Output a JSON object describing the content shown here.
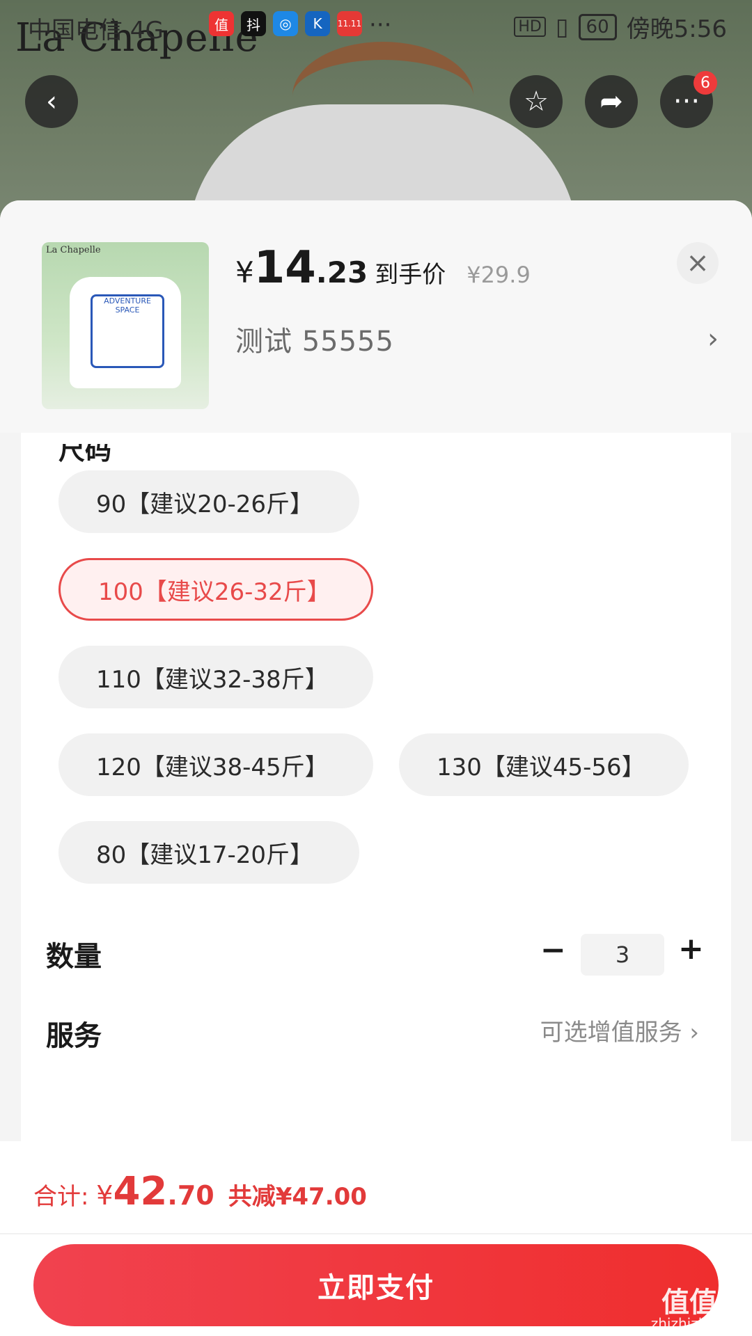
{
  "status_bar": {
    "carrier": "中国电信 4G",
    "time": "傍晚5:56",
    "battery": "60",
    "hd": "HD",
    "apps": [
      {
        "name": "值"
      },
      {
        "name": "抖"
      },
      {
        "name": "◎"
      },
      {
        "name": "K"
      },
      {
        "name": "11.11"
      }
    ],
    "more": "···"
  },
  "hero": {
    "brand": "La Chapelle"
  },
  "nav": {
    "badge_count": "6"
  },
  "product": {
    "thumb_brand": "La Chapelle",
    "thumb_art": "ADVENTURE SPACE",
    "price_symbol": "¥",
    "price_int": "14",
    "price_dec": ".23",
    "price_tag": "到手价",
    "orig_price": "¥29.9",
    "spec_text": "测试  55555"
  },
  "sizes": {
    "title": "尺码",
    "options": [
      {
        "label": "90【建议20-26斤】"
      },
      {
        "label": "100【建议26-32斤】"
      },
      {
        "label": "110【建议32-38斤】"
      },
      {
        "label": "120【建议38-45斤】"
      },
      {
        "label": "130【建议45-56】"
      },
      {
        "label": "80【建议17-20斤】"
      }
    ]
  },
  "quantity": {
    "label": "数量",
    "value": "3",
    "minus": "−",
    "plus": "+"
  },
  "service": {
    "label": "服务",
    "hint": "可选增值服务 ›"
  },
  "footer": {
    "total_label": "合计: ",
    "total_symbol": "¥",
    "total_int": "42",
    "total_dec": ".70",
    "saving": "共减¥47.00",
    "pay_label": "立即支付",
    "watermark": "值值值",
    "watermark_sub": "zhizhizhi.com"
  },
  "colors": {
    "accent": "#ef2e2e",
    "selected_bg": "#fff0f0"
  }
}
